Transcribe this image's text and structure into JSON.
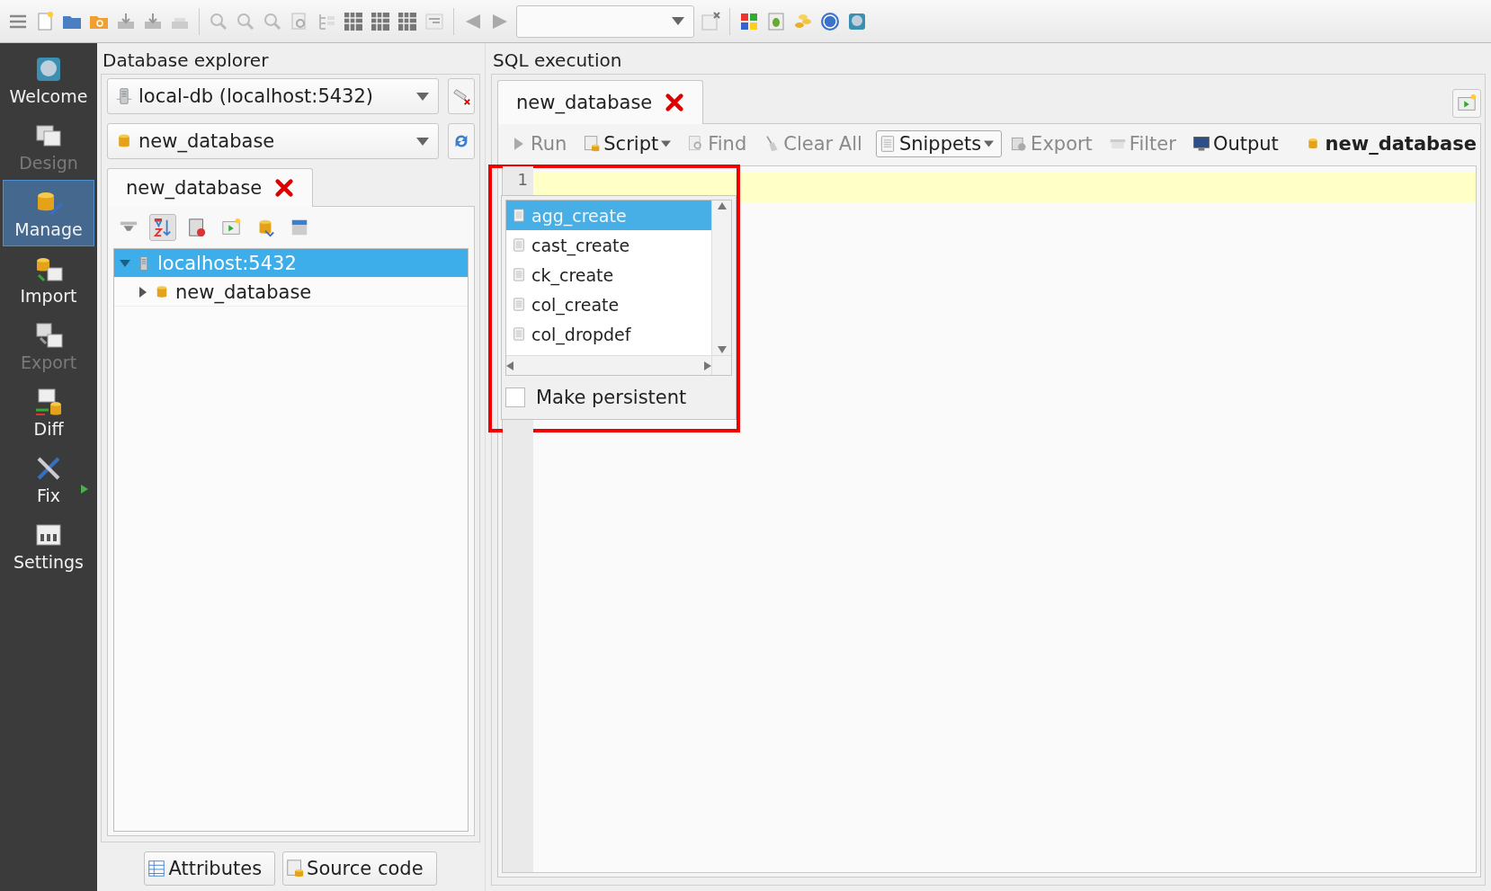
{
  "sidebar": {
    "items": [
      {
        "label": "Welcome",
        "kind": "welcome",
        "selected": false,
        "disabled": false
      },
      {
        "label": "Design",
        "kind": "design",
        "selected": false,
        "disabled": true
      },
      {
        "label": "Manage",
        "kind": "manage",
        "selected": true,
        "disabled": false
      },
      {
        "label": "Import",
        "kind": "import",
        "selected": false,
        "disabled": false
      },
      {
        "label": "Export",
        "kind": "export",
        "selected": false,
        "disabled": true
      },
      {
        "label": "Diff",
        "kind": "diff",
        "selected": false,
        "disabled": false
      },
      {
        "label": "Fix",
        "kind": "fix",
        "selected": false,
        "disabled": false,
        "submenu": true
      },
      {
        "label": "Settings",
        "kind": "settings",
        "selected": false,
        "disabled": false
      }
    ]
  },
  "explorer": {
    "title": "Database explorer",
    "connection": "local-db (localhost:5432)",
    "database": "new_database",
    "tab": {
      "label": "new_database"
    },
    "tree": [
      {
        "label": "localhost:5432",
        "kind": "server",
        "expanded": true,
        "selected": true,
        "children": [
          {
            "label": "new_database",
            "kind": "database",
            "expanded": false,
            "selected": false
          }
        ]
      }
    ],
    "buttons": [
      {
        "label": "Attributes",
        "kind": "attributes"
      },
      {
        "label": "Source code",
        "kind": "source"
      }
    ]
  },
  "sql": {
    "title": "SQL execution",
    "tab": {
      "label": "new_database"
    },
    "actions": [
      {
        "label": "Run",
        "kind": "run",
        "disabled": true
      },
      {
        "label": "Script",
        "kind": "script",
        "disabled": false,
        "menu": true
      },
      {
        "label": "Find",
        "kind": "find",
        "disabled": true
      },
      {
        "label": "Clear All",
        "kind": "clear",
        "disabled": true
      },
      {
        "label": "Snippets",
        "kind": "snippets",
        "disabled": false,
        "menu": true,
        "pressed": true
      },
      {
        "label": "Export",
        "kind": "export",
        "disabled": true
      },
      {
        "label": "Filter",
        "kind": "filter",
        "disabled": true
      },
      {
        "label": "Output",
        "kind": "output",
        "disabled": false
      }
    ],
    "database_label": "new_database",
    "editor": {
      "line_numbers": [
        "1"
      ]
    },
    "snippets_popup": {
      "items": [
        {
          "label": "agg_create",
          "selected": true
        },
        {
          "label": "cast_create",
          "selected": false
        },
        {
          "label": "ck_create",
          "selected": false
        },
        {
          "label": "col_create",
          "selected": false
        },
        {
          "label": "col_dropdef",
          "selected": false
        }
      ],
      "make_persistent": {
        "label": "Make persistent",
        "checked": false
      }
    }
  }
}
